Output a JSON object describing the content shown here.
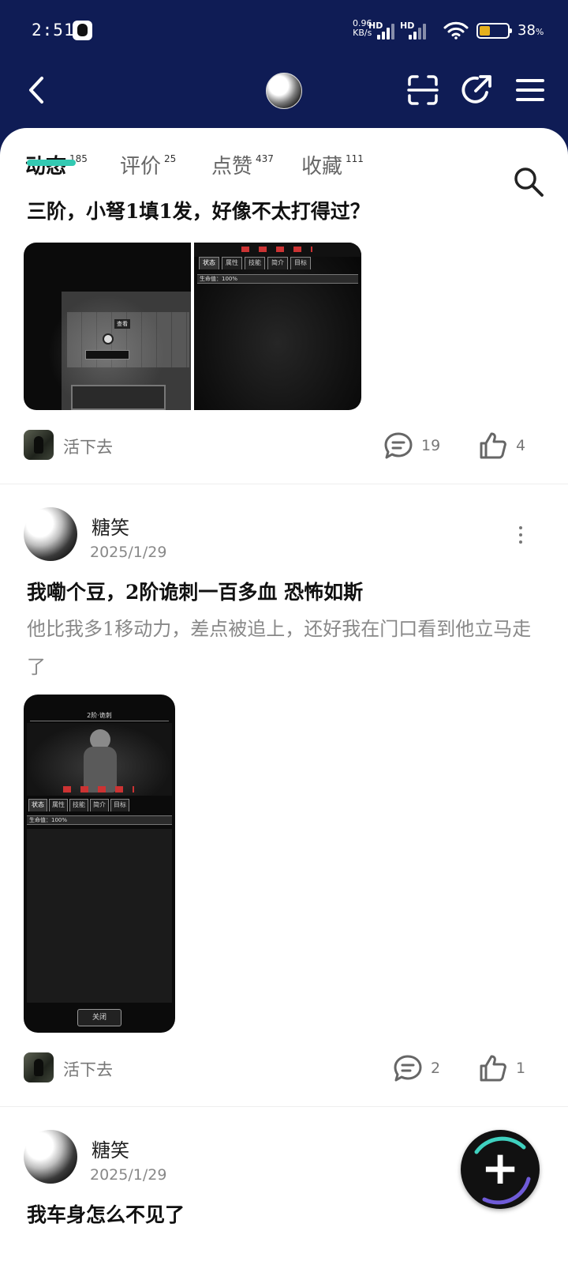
{
  "status_bar": {
    "time": "2:51",
    "net_speed_value": "0.96",
    "net_speed_unit": "KB/s",
    "sim1_label": "HD",
    "sim2_label": "HD",
    "battery": "38",
    "battery_suffix": "%"
  },
  "tabs": [
    {
      "label": "动态",
      "count": "185",
      "active": true
    },
    {
      "label": "评价",
      "count": "25"
    },
    {
      "label": "点赞",
      "count": "437"
    },
    {
      "label": "收藏",
      "count": "111"
    }
  ],
  "posts": [
    {
      "title": "三阶，小弩1填1发，好像不太打得过？",
      "shot_labels": {
        "top": "生命值：100%",
        "tabs": [
          "状态",
          "属性",
          "技能",
          "简介",
          "目标"
        ],
        "interact": "查看"
      },
      "game": "活下去",
      "comments": "19",
      "likes": "4"
    },
    {
      "author": "糖笑",
      "date": "2025/1/29",
      "title": "我嘞个豆，2阶诡刺一百多血 恐怖如斯",
      "body": "他比我多1移动力，差点被追上，还好我在门口看到他立马走了",
      "shot_labels": {
        "header": "2阶·诡刺",
        "tabs": [
          "状态",
          "属性",
          "技能",
          "简介",
          "目标"
        ],
        "hp": "生命值：100%",
        "close": "关闭"
      },
      "game": "活下去",
      "comments": "2",
      "likes": "1"
    },
    {
      "author": "糖笑",
      "date": "2025/1/29",
      "title": "我车身怎么不见了"
    }
  ],
  "icons": {
    "back": "back-arrow-icon",
    "scan": "scan-icon",
    "share": "share-icon",
    "menu": "menu-icon",
    "search": "search-icon",
    "comment": "comment-icon",
    "like": "thumbs-up-icon",
    "more": "more-vertical-icon",
    "add": "plus-icon"
  },
  "colors": {
    "header_bg": "#0f1c55",
    "tab_underline": "#33c9b2",
    "battery_fill": "#e6b01e"
  }
}
